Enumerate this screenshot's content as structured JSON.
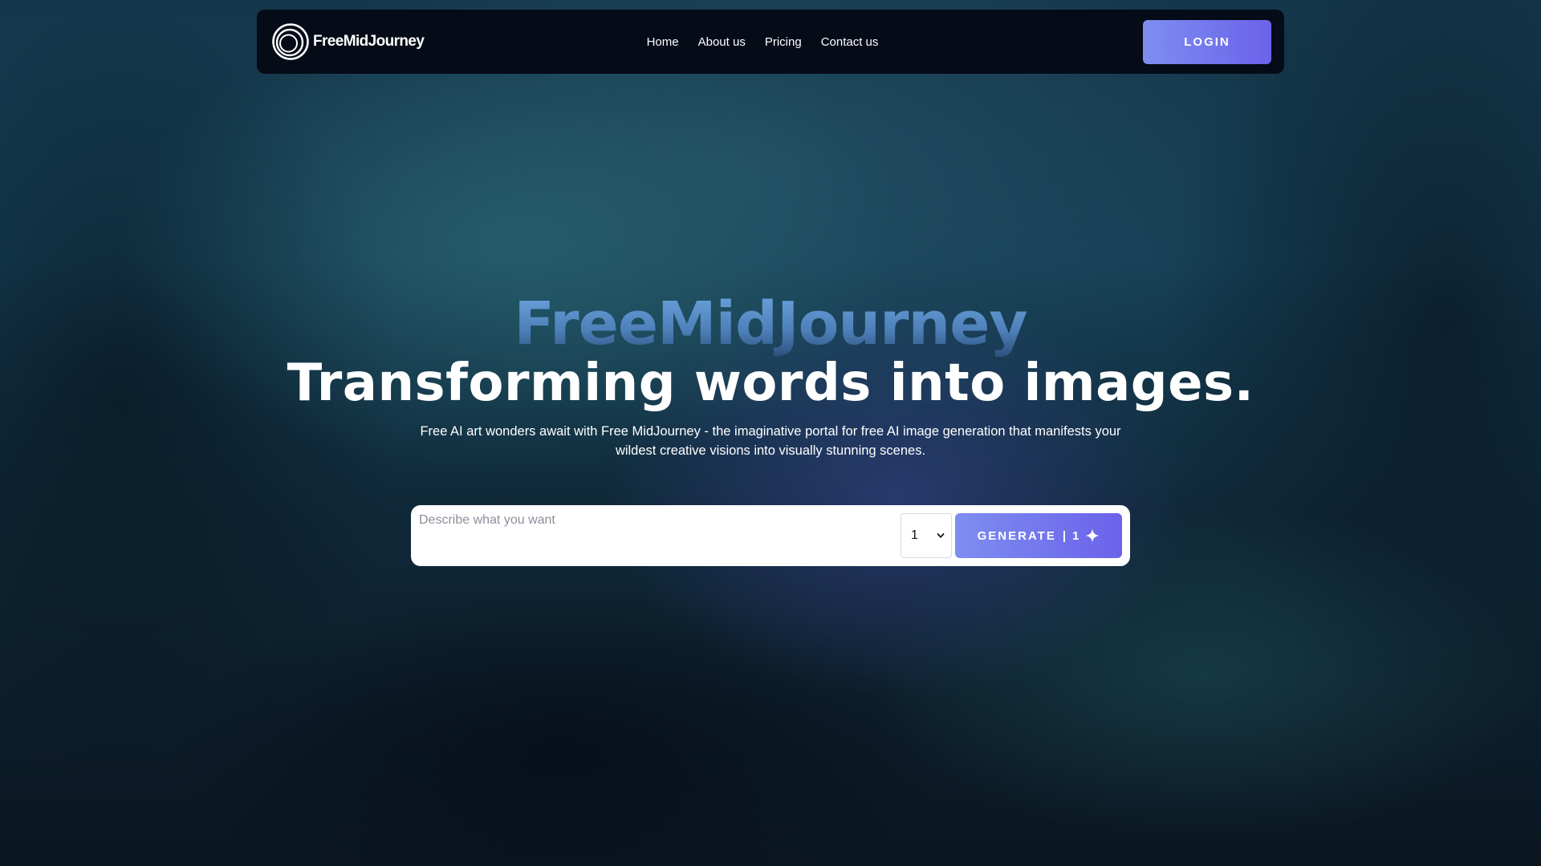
{
  "nav": {
    "logo_text": "FreeMidJourney",
    "links": [
      "Home",
      "About us",
      "Pricing",
      "Contact us"
    ],
    "login_label": "LOGIN"
  },
  "hero": {
    "brand": "FreeMidJourney",
    "title": "Transforming words into images.",
    "description": "Free AI art wonders await with Free MidJourney - the imaginative portal for free AI image generation that manifests your wildest creative visions into visually stunning scenes."
  },
  "prompt": {
    "placeholder": "Describe what you want",
    "count_value": "1",
    "generate_label": "GENERATE",
    "separator": "|",
    "credit_cost": "1"
  },
  "icons": {
    "logo": "concentric-circles-logo-icon",
    "select": "chevron-down-icon",
    "credit": "sparkle-icon"
  },
  "colors": {
    "accent_start": "#7d8ef0",
    "accent_end": "#6b62ea",
    "navbar_bg": "#050b17",
    "brand_text": "#6ea6e0"
  }
}
